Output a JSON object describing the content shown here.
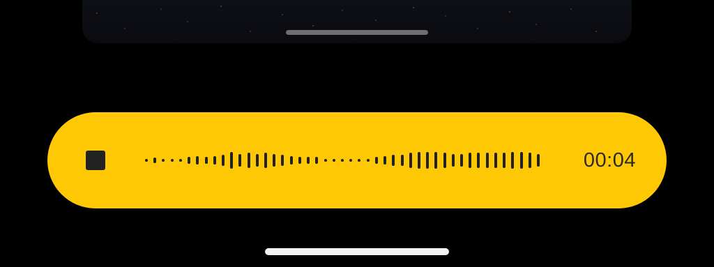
{
  "recorder": {
    "timer": "00:04",
    "stop_icon": "stop-icon",
    "accent": "#FFC805",
    "waveform_levels": [
      0.12,
      0.24,
      0.12,
      0.12,
      0.12,
      0.28,
      0.35,
      0.28,
      0.35,
      0.45,
      0.72,
      0.55,
      0.62,
      0.55,
      0.62,
      0.55,
      0.45,
      0.35,
      0.28,
      0.28,
      0.28,
      0.12,
      0.12,
      0.12,
      0.12,
      0.12,
      0.12,
      0.28,
      0.35,
      0.45,
      0.45,
      0.62,
      0.72,
      0.72,
      0.72,
      0.62,
      0.55,
      0.55,
      0.62,
      0.62,
      0.62,
      0.62,
      0.62,
      0.72,
      0.72,
      0.62,
      0.55
    ]
  },
  "system": {
    "media_handle_icon": "drag-handle-icon",
    "home_indicator_icon": "home-indicator-icon"
  }
}
